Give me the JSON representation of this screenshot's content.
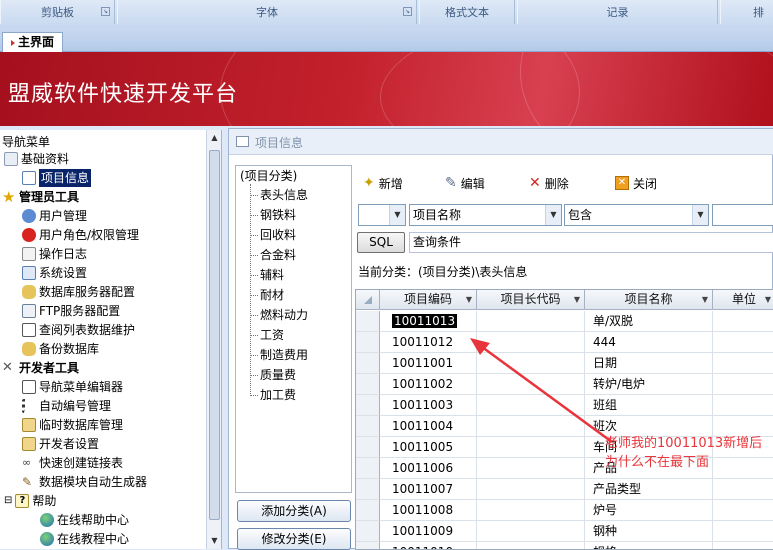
{
  "ribbon": {
    "groups": [
      "剪贴板",
      "字体",
      "格式文本",
      "记录",
      "排"
    ]
  },
  "doc_tab": {
    "label": "主界面"
  },
  "banner": {
    "title": "盟威软件快速开发平台"
  },
  "nav": {
    "title": "导航菜单",
    "items": [
      {
        "label": "基础资料",
        "icon": "folder-icon"
      },
      {
        "label": "项目信息",
        "icon": "form-icon",
        "selected": true
      },
      {
        "label": "管理员工具",
        "icon": "star-icon"
      },
      {
        "label": "用户管理",
        "icon": "users-icon"
      },
      {
        "label": "用户角色/权限管理",
        "icon": "no-entry-icon"
      },
      {
        "label": "操作日志",
        "icon": "log-icon"
      },
      {
        "label": "系统设置",
        "icon": "settings-icon"
      },
      {
        "label": "数据库服务器配置",
        "icon": "database-server-icon"
      },
      {
        "label": "FTP服务器配置",
        "icon": "ftp-icon"
      },
      {
        "label": "查阅列表数据维护",
        "icon": "list-icon"
      },
      {
        "label": "备份数据库",
        "icon": "backup-icon"
      },
      {
        "label": "开发者工具",
        "icon": "tools-icon"
      },
      {
        "label": "导航菜单编辑器",
        "icon": "menu-editor-icon"
      },
      {
        "label": "自动编号管理",
        "icon": "numbering-icon"
      },
      {
        "label": "临时数据库管理",
        "icon": "temp-db-icon"
      },
      {
        "label": "开发者设置",
        "icon": "dev-settings-icon"
      },
      {
        "label": "快速创建链接表",
        "icon": "link-icon"
      },
      {
        "label": "数据模块自动生成器",
        "icon": "generator-icon"
      },
      {
        "label": "帮助",
        "icon": "help-icon"
      },
      {
        "label": "在线帮助中心",
        "icon": "globe-icon"
      },
      {
        "label": "在线教程中心",
        "icon": "globe-icon"
      }
    ]
  },
  "window": {
    "title": "项目信息",
    "category_tree": {
      "root": "(项目分类)",
      "items": [
        "表头信息",
        "钢铁料",
        "回收料",
        "合金料",
        "辅料",
        "耐材",
        "燃料动力",
        "工资",
        "制造费用",
        "质量费",
        "加工费"
      ]
    },
    "buttons": {
      "add_category": "添加分类(A)",
      "edit_category": "修改分类(E)"
    },
    "toolbar": {
      "new": "新增",
      "edit": "编辑",
      "delete": "删除",
      "close": "关闭"
    },
    "filter": {
      "field": "项目名称",
      "operator": "包含",
      "value": ""
    },
    "sql_button": "SQL",
    "sql_condition_label": "查询条件",
    "current_category": "当前分类：(项目分类)\\表头信息",
    "grid": {
      "columns": [
        "项目编码",
        "项目长代码",
        "项目名称",
        "单位"
      ],
      "rows": [
        {
          "code": "10011013",
          "long_code": "",
          "name": "单/双脱",
          "unit": "",
          "selected": true
        },
        {
          "code": "10011012",
          "long_code": "",
          "name": "444",
          "unit": ""
        },
        {
          "code": "10011001",
          "long_code": "",
          "name": "日期",
          "unit": ""
        },
        {
          "code": "10011002",
          "long_code": "",
          "name": "转炉/电炉",
          "unit": ""
        },
        {
          "code": "10011003",
          "long_code": "",
          "name": "班组",
          "unit": ""
        },
        {
          "code": "10011004",
          "long_code": "",
          "name": "班次",
          "unit": ""
        },
        {
          "code": "10011005",
          "long_code": "",
          "name": "车间",
          "unit": ""
        },
        {
          "code": "10011006",
          "long_code": "",
          "name": "产品",
          "unit": ""
        },
        {
          "code": "10011007",
          "long_code": "",
          "name": "产品类型",
          "unit": ""
        },
        {
          "code": "10011008",
          "long_code": "",
          "name": "炉号",
          "unit": ""
        },
        {
          "code": "10011009",
          "long_code": "",
          "name": "钢种",
          "unit": ""
        },
        {
          "code": "10011010",
          "long_code": "",
          "name": "规格",
          "unit": ""
        }
      ]
    }
  },
  "annotation": {
    "text": "老师我的10011013新增后为什么不在最下面",
    "color": "#e8343b"
  },
  "colors": {
    "banner_red": "#c3212c",
    "selection": "#0a246a"
  }
}
